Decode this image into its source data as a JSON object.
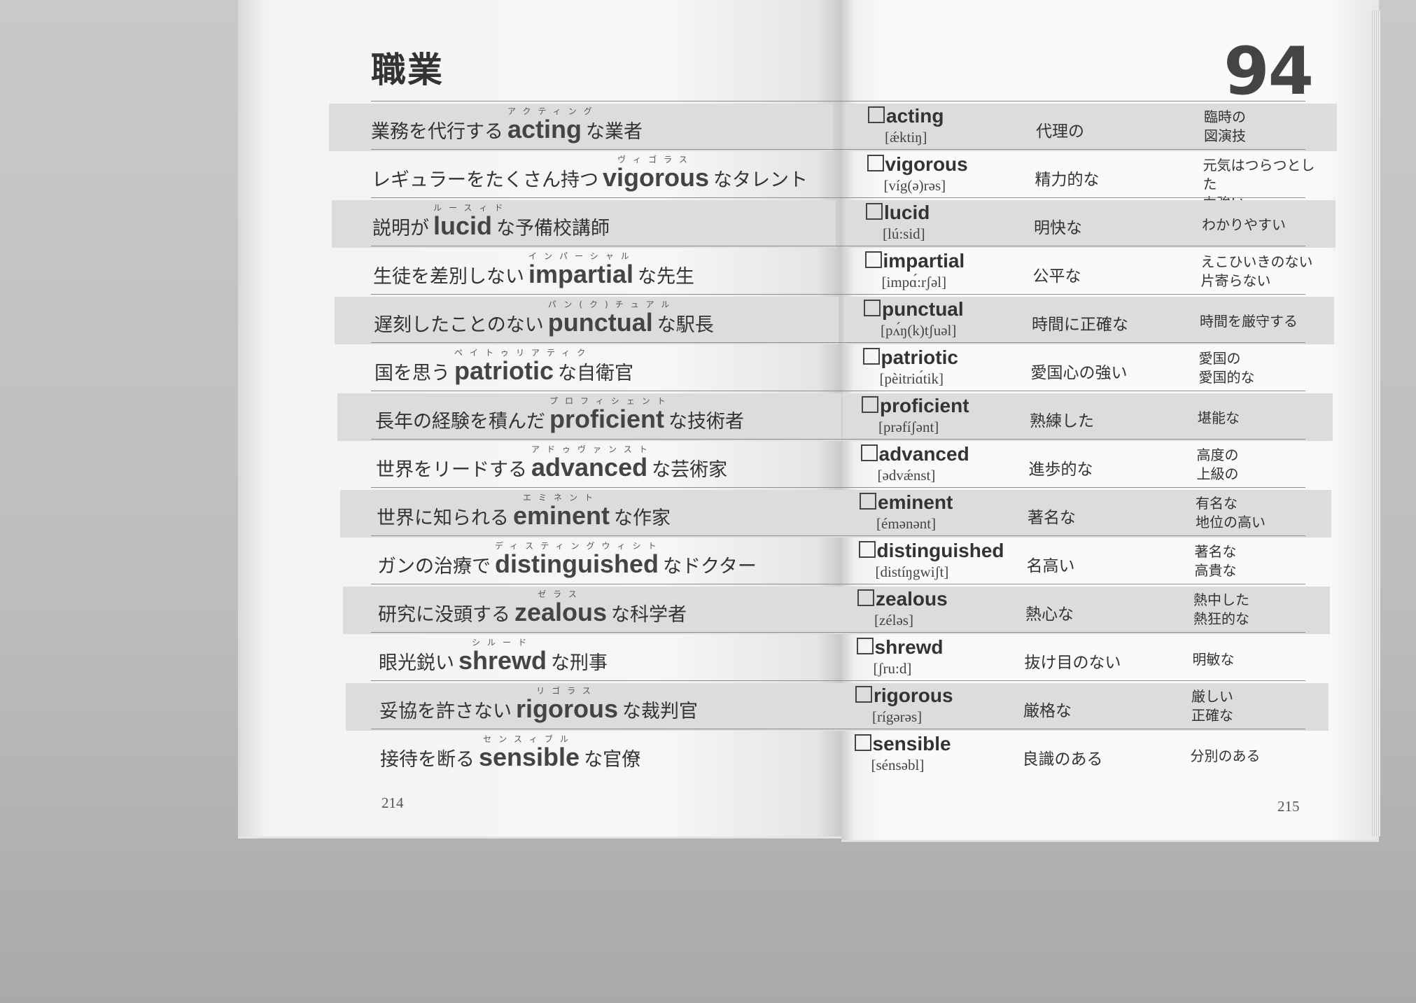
{
  "chapter": {
    "title": "職業",
    "number": "94"
  },
  "page_numbers": {
    "left": "214",
    "right": "215"
  },
  "sentences": [
    {
      "before": "業務を代行する",
      "word": "acting",
      "ruby": "アクティング",
      "after": "な業者"
    },
    {
      "before": "レギュラーをたくさん持つ",
      "word": "vigorous",
      "ruby": "ヴィゴラス",
      "after": "なタレント"
    },
    {
      "before": "説明が",
      "word": "lucid",
      "ruby": "ルースィド",
      "after": "な予備校講師"
    },
    {
      "before": "生徒を差別しない",
      "word": "impartial",
      "ruby": "インパーシャル",
      "after": "な先生"
    },
    {
      "before": "遅刻したことのない",
      "word": "punctual",
      "ruby": "パン(ク)チュアル",
      "after": "な駅長"
    },
    {
      "before": "国を思う",
      "word": "patriotic",
      "ruby": "ペイトゥリアティク",
      "after": "な自衛官"
    },
    {
      "before": "長年の経験を積んだ",
      "word": "proficient",
      "ruby": "プロフィシェント",
      "after": "な技術者"
    },
    {
      "before": "世界をリードする",
      "word": "advanced",
      "ruby": "アドゥヴァンスト",
      "after": "な芸術家"
    },
    {
      "before": "世界に知られる",
      "word": "eminent",
      "ruby": "エミネント",
      "after": "な作家"
    },
    {
      "before": "ガンの治療で",
      "word": "distinguished",
      "ruby": "ディスティングウィシト",
      "after": "なドクター"
    },
    {
      "before": "研究に没頭する",
      "word": "zealous",
      "ruby": "ゼラス",
      "after": "な科学者"
    },
    {
      "before": "眼光鋭い",
      "word": "shrewd",
      "ruby": "シルード",
      "after": "な刑事"
    },
    {
      "before": "妥協を許さない",
      "word": "rigorous",
      "ruby": "リゴラス",
      "after": "な裁判官"
    },
    {
      "before": "接待を断る",
      "word": "sensible",
      "ruby": "センスィブル",
      "after": "な官僚"
    }
  ],
  "entries": [
    {
      "word": "acting",
      "pron": "[ǽktiŋ]",
      "meaning": "代理の",
      "extra": "臨時の\n図演技"
    },
    {
      "word": "vigorous",
      "pron": "[víg(ə)rəs]",
      "meaning": "精力的な",
      "extra": "元気はつらつとした\n力強い"
    },
    {
      "word": "lucid",
      "pron": "[lú:sid]",
      "meaning": "明快な",
      "extra": "わかりやすい"
    },
    {
      "word": "impartial",
      "pron": "[impɑ́:rʃəl]",
      "meaning": "公平な",
      "extra": "えこひいきのない\n片寄らない"
    },
    {
      "word": "punctual",
      "pron": "[pʌ́ŋ(k)tʃuəl]",
      "meaning": "時間に正確な",
      "extra": "時間を厳守する"
    },
    {
      "word": "patriotic",
      "pron": "[pèitriɑ́tik]",
      "meaning": "愛国心の強い",
      "extra": "愛国の\n愛国的な"
    },
    {
      "word": "proficient",
      "pron": "[prəfíʃənt]",
      "meaning": "熟練した",
      "extra": "堪能な"
    },
    {
      "word": "advanced",
      "pron": "[ədvǽnst]",
      "meaning": "進歩的な",
      "extra": "高度の\n上級の"
    },
    {
      "word": "eminent",
      "pron": "[émənənt]",
      "meaning": "著名な",
      "extra": "有名な\n地位の高い"
    },
    {
      "word": "distinguished",
      "pron": "[distíŋgwiʃt]",
      "meaning": "名高い",
      "extra": "著名な\n高貴な"
    },
    {
      "word": "zealous",
      "pron": "[zéləs]",
      "meaning": "熱心な",
      "extra": "熱中した\n熱狂的な"
    },
    {
      "word": "shrewd",
      "pron": "[ʃru:d]",
      "meaning": "抜け目のない",
      "extra": "明敏な"
    },
    {
      "word": "rigorous",
      "pron": "[rígərəs]",
      "meaning": "厳格な",
      "extra": "厳しい\n正確な"
    },
    {
      "word": "sensible",
      "pron": "[sénsəbl]",
      "meaning": "良識のある",
      "extra": "分別のある"
    }
  ]
}
